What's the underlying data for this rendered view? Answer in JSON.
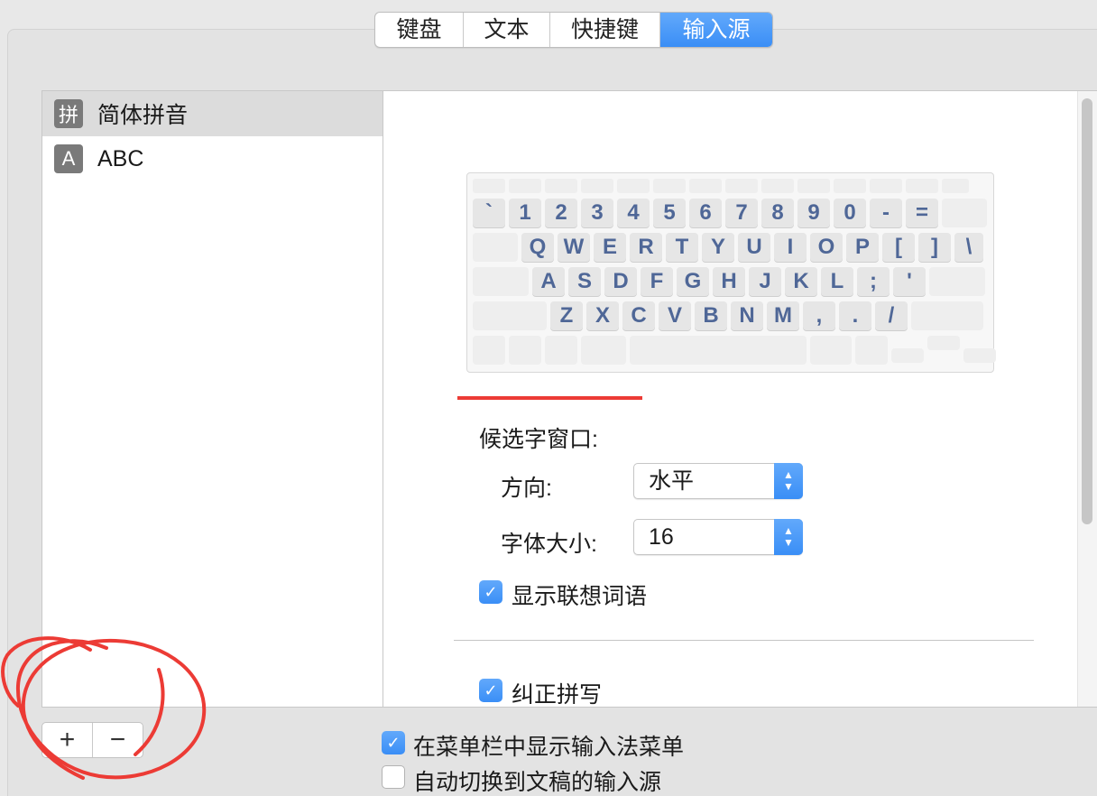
{
  "tabs": [
    "键盘",
    "文本",
    "快捷键",
    "输入源"
  ],
  "active_tab": "输入源",
  "sources": [
    {
      "icon": "拼",
      "label": "简体拼音"
    },
    {
      "icon": "A",
      "label": "ABC"
    }
  ],
  "keyboard": {
    "row1": [
      "`",
      "1",
      "2",
      "3",
      "4",
      "5",
      "6",
      "7",
      "8",
      "9",
      "0",
      "-",
      "="
    ],
    "row2": [
      "Q",
      "W",
      "E",
      "R",
      "T",
      "Y",
      "U",
      "I",
      "O",
      "P",
      "[",
      "]",
      "\\"
    ],
    "row3": [
      "A",
      "S",
      "D",
      "F",
      "G",
      "H",
      "J",
      "K",
      "L",
      ";",
      "'"
    ],
    "row4": [
      "Z",
      "X",
      "C",
      "V",
      "B",
      "N",
      "M",
      ",",
      ".",
      "/"
    ]
  },
  "candidate_window": {
    "title": "候选字窗口:",
    "direction_label": "方向:",
    "direction_value": "水平",
    "font_size_label": "字体大小:",
    "font_size_value": "16",
    "show_associated_label": "显示联想词语",
    "show_associated_checked": true
  },
  "correct_spelling_label": "纠正拼写",
  "correct_spelling_checked": true,
  "show_menu_label": "在菜单栏中显示输入法菜单",
  "show_menu_checked": true,
  "auto_switch_label": "自动切换到文稿的输入源",
  "auto_switch_checked": false,
  "add_button": "+",
  "remove_button": "−",
  "accent_color": "#3a8ef6",
  "annotation_color": "#ec3b35"
}
